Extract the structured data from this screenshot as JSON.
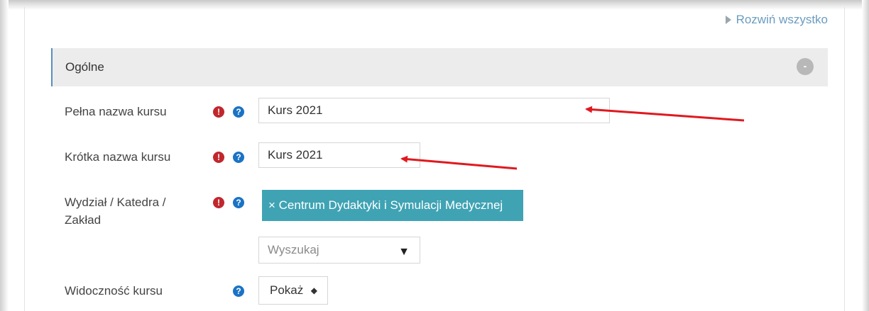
{
  "header": {
    "expand_all": "Rozwiń wszystko"
  },
  "section": {
    "title": "Ogólne",
    "collapse_symbol": "-"
  },
  "fields": {
    "full_name": {
      "label": "Pełna nazwa kursu",
      "value": "Kurs 2021"
    },
    "short_name": {
      "label": "Krótka nazwa kursu",
      "value": "Kurs 2021"
    },
    "department": {
      "label_line1": "Wydział / Katedra /",
      "label_line2": "Zakład",
      "selected_tag": "× Centrum Dydaktyki i Symulacji Medycznej",
      "search_placeholder": "Wyszukaj",
      "search_arrow": "▼"
    },
    "visibility": {
      "label": "Widoczność kursu",
      "selected": "Pokaż",
      "caret": "◆"
    }
  },
  "icons": {
    "required": "!",
    "help": "?"
  },
  "colors": {
    "required_icon": "#c0272d",
    "help_icon": "#1a73c5",
    "tag_background": "#3fa3b4",
    "link": "#6b9cc0",
    "annotation_arrow": "#e0191f"
  }
}
